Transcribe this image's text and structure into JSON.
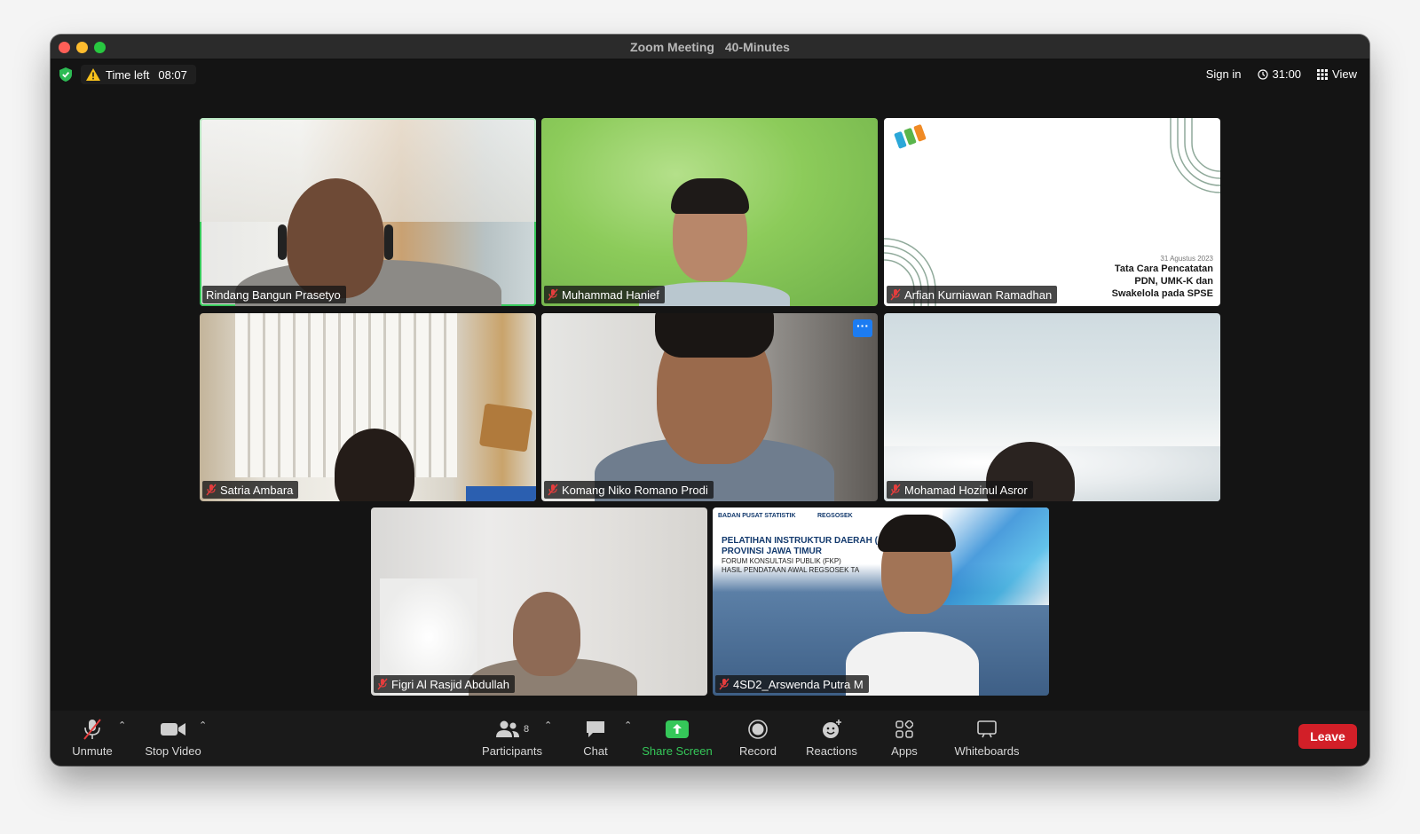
{
  "window": {
    "title": "Zoom Meeting",
    "subtitle": "40-Minutes"
  },
  "topbar": {
    "time_left_label": "Time left",
    "time_left_value": "08:07",
    "sign_in": "Sign in",
    "clock": "31:00",
    "view": "View"
  },
  "participants": [
    {
      "name": "Rindang Bangun Prasetyo",
      "muted": false,
      "active": true
    },
    {
      "name": "Muhammad Hanief",
      "muted": true
    },
    {
      "name": "Arfian Kurniawan Ramadhan",
      "muted": true
    },
    {
      "name": "Satria Ambara",
      "muted": true
    },
    {
      "name": "Komang Niko Romano Prodi",
      "muted": true
    },
    {
      "name": "Mohamad Hozinul Asror",
      "muted": true
    },
    {
      "name": "Figri Al Rasjid Abdullah",
      "muted": true
    },
    {
      "name": "4SD2_Arswenda Putra M",
      "muted": true
    }
  ],
  "slide": {
    "date": "31 Agustus 2023",
    "line1": "Tata Cara Pencatatan",
    "line2": "PDN, UMK-K dan",
    "line3": "Swakelola pada SPSE"
  },
  "banner": {
    "org": "BADAN PUSAT STATISTIK",
    "brand": "REGSOSEK",
    "line1": "PELATIHAN INSTRUKTUR DAERAH (",
    "line2": "PROVINSI JAWA TIMUR",
    "line3": "FORUM KONSULTASI PUBLIK (FKP)",
    "line4": "HASIL PENDATAAN AWAL REGSOSEK TA"
  },
  "toolbar": {
    "unmute": "Unmute",
    "stop_video": "Stop Video",
    "participants": "Participants",
    "participants_count": "8",
    "chat": "Chat",
    "share_screen": "Share Screen",
    "record": "Record",
    "reactions": "Reactions",
    "apps": "Apps",
    "whiteboards": "Whiteboards",
    "leave": "Leave"
  },
  "colors": {
    "active_speaker": "#35c759",
    "share": "#35c759",
    "leave": "#d21f28",
    "more": "#1c7cf2"
  }
}
